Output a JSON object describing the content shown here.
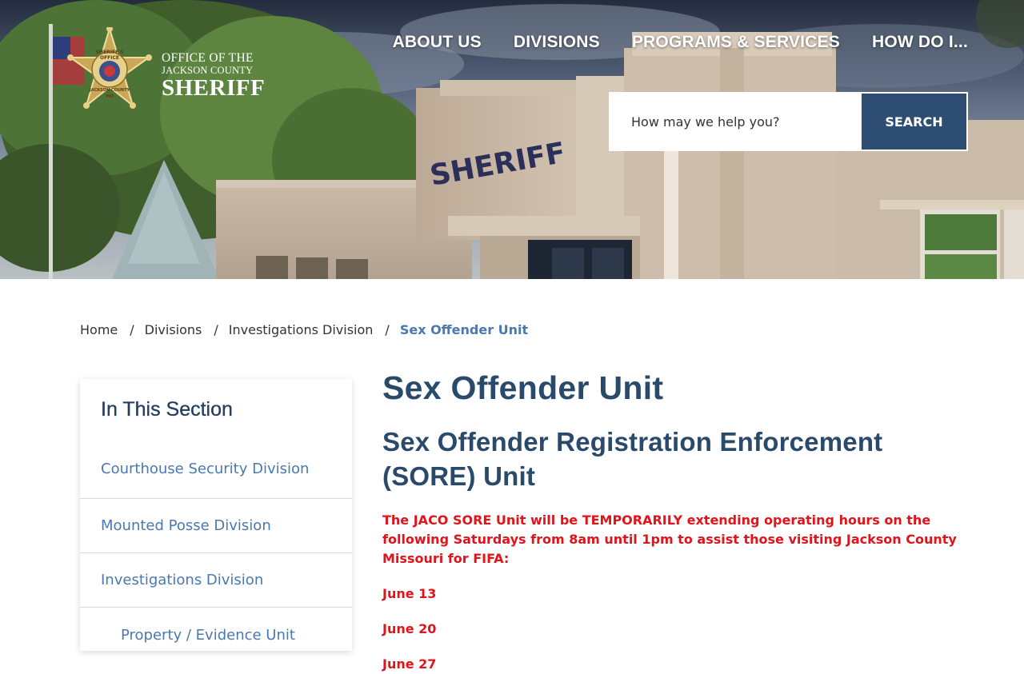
{
  "header": {
    "logo": {
      "line1": "OFFICE OF THE",
      "line2": "JACKSON COUNTY",
      "line3": "SHERIFF",
      "badge_text": [
        "SHERIFF'S",
        "OFFICE",
        "JACKSON COUNTY",
        "MO"
      ]
    },
    "nav": [
      "ABOUT US",
      "DIVISIONS",
      "PROGRAMS & SERVICES",
      "HOW DO I..."
    ],
    "search": {
      "placeholder": "How may we help you?",
      "button": "SEARCH"
    },
    "building_sign": "SHERIFF"
  },
  "breadcrumb": [
    "Home",
    "Divisions",
    "Investigations Division",
    "Sex Offender Unit"
  ],
  "sidebar": {
    "title": "In This Section",
    "items": [
      {
        "label": "Courthouse Security Division"
      },
      {
        "label": "Mounted Posse Division"
      },
      {
        "label": "Investigations Division"
      },
      {
        "label": "Property / Evidence Unit"
      }
    ]
  },
  "main": {
    "title": "Sex Offender Unit",
    "subtitle": "Sex Offender Registration Enforcement (SORE) Unit",
    "notice": "The JACO SORE Unit will be TEMPORARILY extending operating hours on the following Saturdays from 8am until 1pm to assist those visiting Jackson County Missouri for FIFA:",
    "dates": [
      "June 13",
      "June 20",
      "June 27"
    ]
  },
  "colors": {
    "primary": "#2a4a6c",
    "link": "#4a78b0",
    "search_button": "#2d4d73",
    "alert": "#e0141a"
  }
}
